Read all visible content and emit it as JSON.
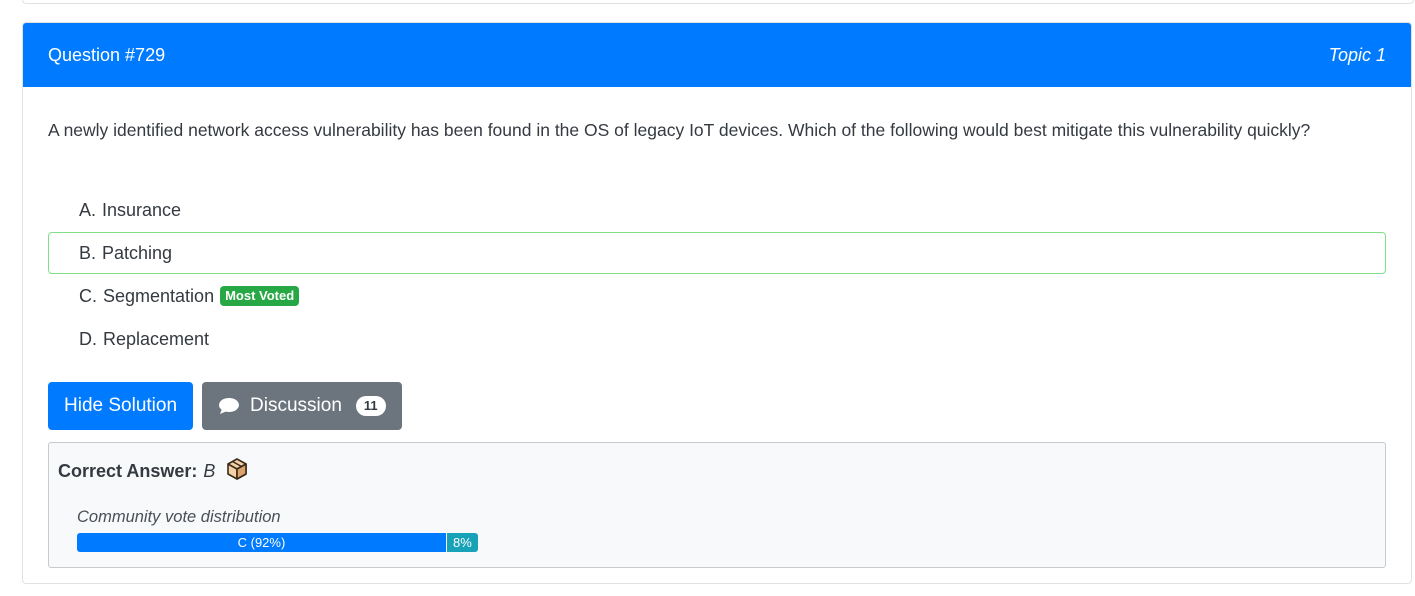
{
  "header": {
    "question_label": "Question #729",
    "topic_label": "Topic 1",
    "color": "#007bff"
  },
  "question": {
    "text": "A newly identified network access vulnerability has been found in the OS of legacy IoT devices. Which of the following would best mitigate this vulnerability quickly?"
  },
  "choices": [
    {
      "letter": "A.",
      "text": "Insurance",
      "correct": false,
      "badge": ""
    },
    {
      "letter": "B.",
      "text": "Patching",
      "correct": true,
      "badge": ""
    },
    {
      "letter": "C.",
      "text": "Segmentation",
      "correct": false,
      "badge": "Most Voted"
    },
    {
      "letter": "D.",
      "text": "Replacement",
      "correct": false,
      "badge": ""
    }
  ],
  "actions": {
    "hide_solution_label": "Hide Solution",
    "discussion_label": "Discussion",
    "discussion_count": "11",
    "discussion_icon": "speech-bubble-icon"
  },
  "answer": {
    "label": "Correct Answer:",
    "value": "B",
    "icon": "answer-box-icon",
    "vote_title": "Community vote distribution",
    "votes": [
      {
        "label": "C (92%)",
        "percent": 92,
        "color": "#007bff"
      },
      {
        "label": "8%",
        "percent": 8,
        "color": "#17a2b8"
      }
    ]
  }
}
